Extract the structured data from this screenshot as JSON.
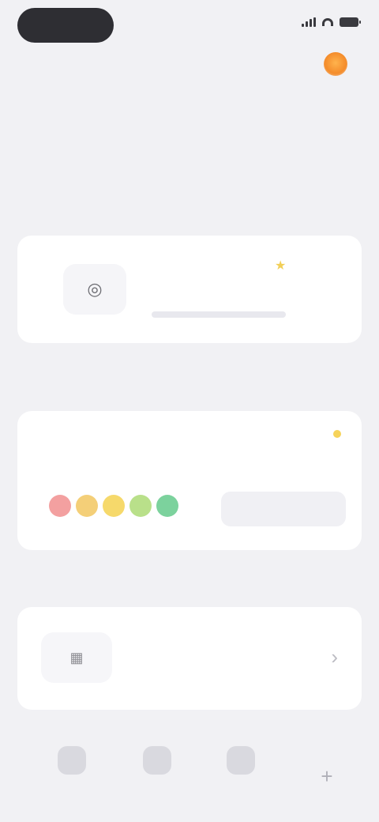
{
  "status_bar": {
    "time": "",
    "signal_icon": "signal-icon",
    "wifi_icon": "wifi-icon",
    "battery_icon": "battery-icon"
  },
  "header": {
    "title": "",
    "streak_count": "",
    "streak_icon": "flame-icon"
  },
  "week": {
    "days": [
      "",
      "",
      "",
      "",
      "",
      "",
      ""
    ]
  },
  "sections": {
    "focus": "",
    "log": "",
    "insights": ""
  },
  "focus_card": {
    "icon": "target-icon",
    "title": "",
    "subtitle": "",
    "progress": 0.0
  },
  "log_card": {
    "title": "",
    "subtitle": "",
    "status": "",
    "button_label": "",
    "moods": [
      "#f3a0a0",
      "#f4cf78",
      "#f6d96b",
      "#b9e08a",
      "#7cd29d"
    ]
  },
  "insights_card": {
    "icon": "chart-icon",
    "title": "",
    "subtitle": ""
  },
  "tabbar": {
    "tabs": [
      {
        "label": "",
        "icon": "home-icon"
      },
      {
        "label": "",
        "icon": "calendar-icon"
      },
      {
        "label": "",
        "icon": "stats-icon"
      }
    ],
    "add_icon": "plus-icon"
  },
  "colors": {
    "background": "#f1f1f4",
    "card": "#ffffff",
    "accent": "#f48c2b"
  }
}
